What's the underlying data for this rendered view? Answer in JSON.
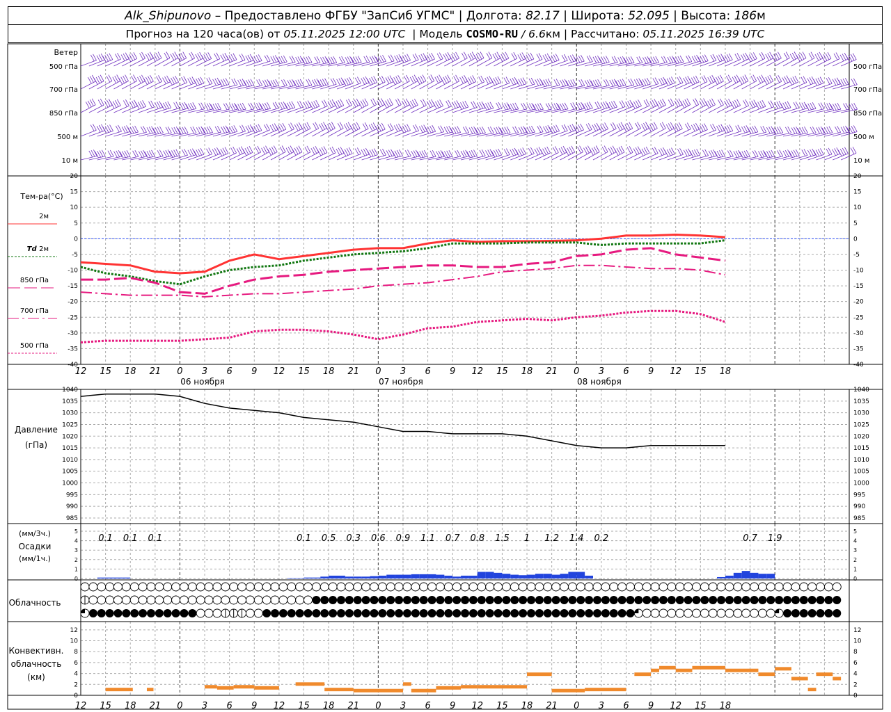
{
  "header": {
    "line1": {
      "station": "Alk_Shipunovo",
      "provided": "– Предоставлено ФГБУ \"ЗапСиб УГМС\" | Долгота:",
      "lon": "82.17",
      "lat_label": "| Широта:",
      "lat": "52.095",
      "alt_label": "| Высота:",
      "alt": "186",
      "alt_unit": "м"
    },
    "line2": {
      "forecast": "Прогноз на 120 часа(ов) от",
      "init": "05.11.2025 12:00 UTC",
      "model_label": "| Модель",
      "model": "COSMO-RU",
      "res": "/ 6.6",
      "res_unit": "км",
      "calc_label": "| Рассчитано:",
      "calc": "05.11.2025 16:39 UTC"
    }
  },
  "panels": {
    "wind": {
      "title": "Ветер",
      "levels": [
        "500 гПа",
        "700 гПа",
        "850 гПа",
        "500 м",
        "10 м"
      ]
    },
    "temperature": {
      "title": "Тем-ра(°C)",
      "legend": [
        {
          "label": "2м",
          "color": "#ff3333",
          "dash": "solid"
        },
        {
          "label_italic": "Td",
          "label": "2м",
          "color": "#117711",
          "dash": "dotted"
        },
        {
          "label": "850 гПа",
          "color": "#e6197f",
          "dash": "dashed"
        },
        {
          "label": "700 гПа",
          "color": "#e6197f",
          "dash": "dashdot"
        },
        {
          "label": "500 гПа",
          "color": "#e6197f",
          "dash": "dotted"
        }
      ],
      "yticks": [
        "20",
        "15",
        "10",
        "5",
        "0",
        "-5",
        "-10",
        "-15",
        "-20",
        "-25",
        "-30",
        "-35",
        "-40"
      ]
    },
    "pressure": {
      "title": "Давление",
      "unit": "(гПа)",
      "yticks": [
        "1040",
        "1035",
        "1030",
        "1025",
        "1020",
        "1015",
        "1010",
        "1005",
        "1000",
        "995",
        "990",
        "985"
      ]
    },
    "precip": {
      "unit1": "(мм/3ч.)",
      "title": "Осадки",
      "unit2": "(мм/1ч.)",
      "yticks": [
        "5",
        "4",
        "3",
        "2",
        "1",
        "0"
      ],
      "labels": [
        {
          "h": 3,
          "t": "0.1"
        },
        {
          "h": 6,
          "t": "0.1"
        },
        {
          "h": 9,
          "t": "0.1"
        },
        {
          "h": 27,
          "t": "0.1"
        },
        {
          "h": 30,
          "t": "0.5"
        },
        {
          "h": 33,
          "t": "0.3"
        },
        {
          "h": 36,
          "t": "0.6"
        },
        {
          "h": 39,
          "t": "0.9"
        },
        {
          "h": 42,
          "t": "1.1"
        },
        {
          "h": 45,
          "t": "0.7"
        },
        {
          "h": 48,
          "t": "0.8"
        },
        {
          "h": 51,
          "t": "1.5"
        },
        {
          "h": 54,
          "t": "1"
        },
        {
          "h": 57,
          "t": "1.2"
        },
        {
          "h": 60,
          "t": "1.4"
        },
        {
          "h": 63,
          "t": "0.2"
        },
        {
          "h": 81,
          "t": "0.7"
        },
        {
          "h": 84,
          "t": "1.9"
        }
      ]
    },
    "cloud": {
      "title": "Облачность"
    },
    "convective": {
      "title1": "Конвективн.",
      "title2": "облачность",
      "unit": "(км)",
      "yticks": [
        "12",
        "10",
        "8",
        "6",
        "4",
        "2",
        "0"
      ]
    }
  },
  "time_axis": {
    "hour_labels": [
      "12",
      "15",
      "18",
      "21",
      "0",
      "3",
      "6",
      "9",
      "12",
      "15",
      "18",
      "21",
      "0",
      "3",
      "6",
      "9",
      "12",
      "15",
      "18",
      "21",
      "0",
      "3",
      "6",
      "9",
      "12",
      "15",
      "18"
    ],
    "dates": [
      "06 ноября",
      "07 ноября",
      "08 ноября"
    ]
  },
  "chart_data": {
    "type": "line",
    "x_unit": "hours since 05.11.2025 12:00 UTC",
    "x": [
      0,
      3,
      6,
      9,
      12,
      15,
      18,
      21,
      24,
      27,
      30,
      33,
      36,
      39,
      42,
      45,
      48,
      51,
      54,
      57,
      60,
      63,
      66,
      69,
      72,
      75,
      78
    ],
    "series": [
      {
        "name": "2м",
        "unit": "°C",
        "values": [
          -7.5,
          -8,
          -8.5,
          -10.5,
          -11,
          -10.5,
          -7,
          -5,
          -6.5,
          -5.5,
          -4.5,
          -3.5,
          -3,
          -3,
          -1.5,
          -0.5,
          -1,
          -0.8,
          -0.8,
          -0.7,
          -0.5,
          0,
          1,
          1,
          1.3,
          1,
          0.5
        ]
      },
      {
        "name": "Td 2м",
        "unit": "°C",
        "values": [
          -9,
          -11,
          -12,
          -13.5,
          -14.5,
          -12,
          -10,
          -9,
          -8.5,
          -7,
          -6,
          -5,
          -4.5,
          -4,
          -3,
          -1.5,
          -1.5,
          -1.5,
          -1.2,
          -1.2,
          -1.2,
          -2,
          -1.5,
          -1.5,
          -1.5,
          -1.5,
          -0.5
        ]
      },
      {
        "name": "850 гПа",
        "unit": "°C",
        "values": [
          -13,
          -13,
          -12.5,
          -14,
          -17,
          -17.5,
          -15,
          -13,
          -12,
          -11.5,
          -10.5,
          -10,
          -9.5,
          -9,
          -8.5,
          -8.5,
          -9,
          -9,
          -8,
          -7.5,
          -5.5,
          -5,
          -3.5,
          -3,
          -5,
          -6,
          -7
        ]
      },
      {
        "name": "700 гПа",
        "unit": "°C",
        "values": [
          -17,
          -17.5,
          -18,
          -18,
          -18,
          -18.5,
          -18,
          -17.5,
          -17.5,
          -17,
          -16.5,
          -16,
          -15,
          -14.5,
          -14,
          -13,
          -12,
          -10.5,
          -10,
          -9.5,
          -8.5,
          -8.5,
          -9,
          -9.5,
          -9.5,
          -10,
          -11.5
        ]
      },
      {
        "name": "500 гПа",
        "unit": "°C",
        "values": [
          -33,
          -32.5,
          -32.5,
          -32.5,
          -32.5,
          -32,
          -31.5,
          -29.5,
          -29,
          -29,
          -29.5,
          -30.5,
          -32,
          -30.5,
          -28.5,
          -28,
          -26.5,
          -26,
          -25.5,
          -26,
          -25,
          -24.5,
          -23.5,
          -23,
          -23,
          -24,
          -26.5
        ]
      },
      {
        "name": "Давление",
        "unit": "гПа",
        "values": [
          1037,
          1038,
          1038,
          1038,
          1037,
          1034,
          1032,
          1031,
          1030,
          1028,
          1027,
          1026,
          1024,
          1022,
          1022,
          1021,
          1021,
          1021,
          1020,
          1018,
          1016,
          1015,
          1015,
          1016,
          1016,
          1016,
          1016
        ]
      }
    ],
    "precip_mm_per_h": [
      0,
      0,
      0.1,
      0.1,
      0.1,
      0.1,
      0,
      0,
      0,
      0,
      0,
      0,
      0,
      0,
      0,
      0,
      0,
      0,
      0,
      0,
      0,
      0,
      0,
      0,
      0,
      0.05,
      0.05,
      0.1,
      0.1,
      0.2,
      0.3,
      0.3,
      0.2,
      0.2,
      0.2,
      0.25,
      0.3,
      0.4,
      0.4,
      0.4,
      0.45,
      0.45,
      0.45,
      0.4,
      0.3,
      0.2,
      0.3,
      0.3,
      0.7,
      0.7,
      0.6,
      0.5,
      0.4,
      0.35,
      0.4,
      0.5,
      0.5,
      0.4,
      0.5,
      0.7,
      0.7,
      0.3,
      0,
      0,
      0,
      0,
      0,
      0,
      0,
      0,
      0,
      0,
      0,
      0,
      0,
      0,
      0,
      0.15,
      0.3,
      0.6,
      0.8,
      0.6,
      0.5,
      0.5
    ],
    "precip_ylim": [
      0,
      5
    ],
    "temp_ylim": [
      -40,
      20
    ],
    "pressure_ylim": [
      985,
      1040
    ],
    "convective_ylim": [
      0,
      13
    ],
    "convective_base_km": [
      [
        3,
        6.3,
        1.0
      ],
      [
        8,
        8.8,
        1.0
      ],
      [
        15,
        16.5,
        1.5
      ],
      [
        16.5,
        18.5,
        1.3
      ],
      [
        18.5,
        21,
        1.5
      ],
      [
        21,
        24,
        1.3
      ],
      [
        26,
        29.5,
        2.0
      ],
      [
        29.5,
        33,
        1.0
      ],
      [
        33,
        39,
        0.8
      ],
      [
        39,
        40,
        2.0
      ],
      [
        40,
        43,
        0.8
      ],
      [
        43,
        46,
        1.3
      ],
      [
        46,
        48,
        1.5
      ],
      [
        48,
        54,
        1.5
      ],
      [
        54,
        57,
        3.8
      ],
      [
        57,
        61,
        0.8
      ],
      [
        61,
        66,
        1.0
      ],
      [
        67,
        69,
        3.8
      ],
      [
        69,
        70,
        4.5
      ],
      [
        70,
        72,
        5.0
      ],
      [
        72,
        74,
        4.5
      ],
      [
        74,
        78,
        5.0
      ],
      [
        78,
        82,
        4.5
      ],
      [
        82,
        84,
        3.8
      ],
      [
        84,
        86,
        4.8
      ],
      [
        86,
        88,
        3.0
      ],
      [
        88,
        89,
        1.0
      ],
      [
        89,
        91,
        3.8
      ],
      [
        91,
        92,
        3.0
      ]
    ],
    "cloud_low": [
      "0",
      "0",
      "0",
      "0",
      "0",
      "0",
      "0",
      "0",
      "0",
      "0",
      "0",
      "0",
      "0",
      "0",
      "0",
      "0",
      "0",
      "0",
      "0",
      "0",
      "0",
      "0",
      "0",
      "0",
      "0",
      "0",
      "0",
      "0",
      "0",
      "0",
      "0",
      "0",
      "0",
      "0",
      "0",
      "0",
      "0",
      "0",
      "0",
      "0",
      "0",
      "0",
      "0",
      "0",
      "0",
      "0",
      "0",
      "0",
      "0",
      "0",
      "0",
      "0",
      "0",
      "0",
      "0",
      "0",
      "0",
      "0",
      "0",
      "0",
      "0",
      "0",
      "0",
      "0",
      "0",
      "0",
      "0",
      "0",
      "0",
      "0",
      "0",
      "0",
      "0",
      "0",
      "0",
      "0",
      "0",
      "0",
      "0",
      "0",
      "0",
      "0",
      "0",
      "0",
      "0",
      "0",
      "0",
      "0",
      "0",
      "0",
      "0",
      "0"
    ],
    "cloud_mid": [
      "h",
      "0",
      "0",
      "0",
      "0",
      "0",
      "0",
      "0",
      "0",
      "0",
      "0",
      "0",
      "0",
      "0",
      "0",
      "0",
      "0",
      "0",
      "0",
      "0",
      "0",
      "0",
      "0",
      "0",
      "0",
      "0",
      "0",
      "0",
      "f",
      "f",
      "f",
      "f",
      "f",
      "f",
      "f",
      "f",
      "f",
      "f",
      "f",
      "f",
      "f",
      "f",
      "f",
      "f",
      "f",
      "f",
      "f",
      "f",
      "f",
      "f",
      "f",
      "f",
      "f",
      "f",
      "f",
      "f",
      "f",
      "f",
      "f",
      "f",
      "f",
      "f",
      "f",
      "f",
      "f",
      "f",
      "f",
      "f",
      "f",
      "f",
      "f",
      "f",
      "f",
      "f",
      "f",
      "f",
      "f",
      "f",
      "f",
      "f",
      "f",
      "f",
      "f",
      "f",
      "f",
      "f",
      "f",
      "f",
      "f",
      "f",
      "f",
      "f"
    ],
    "cloud_high": [
      "q",
      "f",
      "f",
      "f",
      "f",
      "f",
      "f",
      "f",
      "f",
      "f",
      "f",
      "f",
      "f",
      "f",
      "0",
      "0",
      "0",
      "h",
      "h",
      "h",
      "0",
      "0",
      "f",
      "f",
      "f",
      "f",
      "f",
      "f",
      "f",
      "f",
      "f",
      "f",
      "f",
      "f",
      "f",
      "f",
      "f",
      "f",
      "f",
      "f",
      "f",
      "f",
      "f",
      "f",
      "f",
      "f",
      "f",
      "f",
      "f",
      "f",
      "f",
      "f",
      "f",
      "f",
      "f",
      "f",
      "f",
      "f",
      "f",
      "f",
      "f",
      "f",
      "f",
      "f",
      "f",
      "f",
      "f",
      "q",
      "0",
      "0",
      "0",
      "0",
      "0",
      "0",
      "0",
      "0",
      "0",
      "0",
      "0",
      "0",
      "0",
      "0",
      "0",
      "0",
      "q",
      "f",
      "f",
      "f",
      "f",
      "f",
      "f",
      "f"
    ]
  }
}
